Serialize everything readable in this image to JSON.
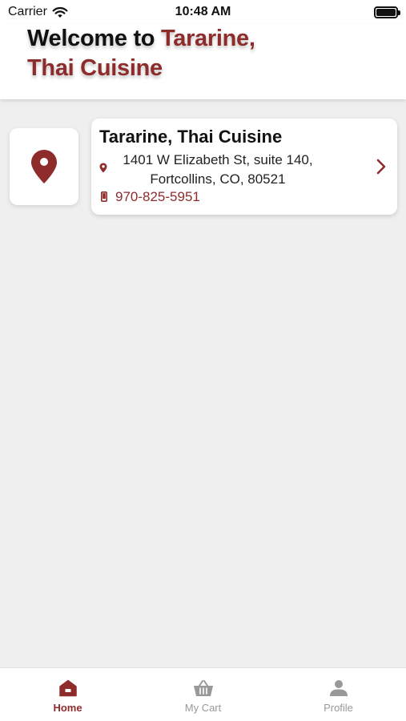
{
  "status_bar": {
    "carrier": "Carrier",
    "time": "10:48 AM"
  },
  "header": {
    "title_prefix": "Welcome to ",
    "title_accent_line1": "Tararine,",
    "title_accent_line2": "Thai Cuisine"
  },
  "restaurant": {
    "name": "Tararine, Thai Cuisine",
    "address_line1": "1401 W Elizabeth St, suite 140,",
    "address_line2": "Fortcollins, CO, 80521",
    "phone": "970-825-5951"
  },
  "tabs": [
    {
      "label": "Home",
      "icon": "home-icon",
      "active": true
    },
    {
      "label": "My Cart",
      "icon": "basket-icon",
      "active": false
    },
    {
      "label": "Profile",
      "icon": "person-icon",
      "active": false
    }
  ],
  "colors": {
    "accent": "#8e2c2c",
    "background": "#efefef",
    "inactive": "#999999"
  }
}
